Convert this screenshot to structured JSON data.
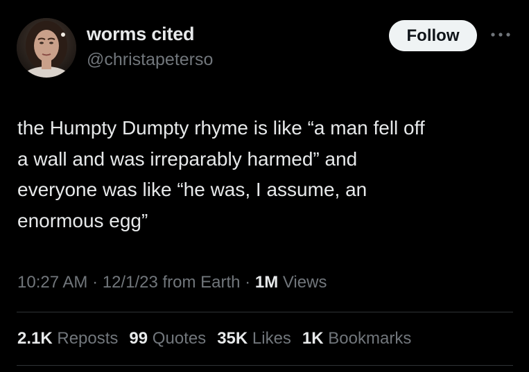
{
  "author": {
    "display_name": "worms cited",
    "handle": "@christapeterso"
  },
  "follow_label": "Follow",
  "tweet": {
    "lines": [
      "the Humpty Dumpty rhyme is like “a man fell off",
      "a wall and was irreparably harmed” and",
      "everyone was like “he was, I assume, an",
      "enormous egg”"
    ]
  },
  "meta": {
    "time": "10:27 AM",
    "sep1": " · ",
    "date": "12/1/23",
    "source": " from Earth",
    "sep2": " · ",
    "views_count": "1M",
    "views_label": " Views"
  },
  "stats": {
    "reposts_count": "2.1K",
    "reposts_label": "Reposts",
    "quotes_count": "99",
    "quotes_label": "Quotes",
    "likes_count": "35K",
    "likes_label": "Likes",
    "bookmarks_count": "1K",
    "bookmarks_label": "Bookmarks"
  },
  "icons": {
    "more": "more-options-icon"
  },
  "colors": {
    "background": "#000000",
    "text": "#e7e9ea",
    "secondary": "#71767b",
    "follow_bg": "#eff3f4",
    "divider": "#2f3336"
  }
}
